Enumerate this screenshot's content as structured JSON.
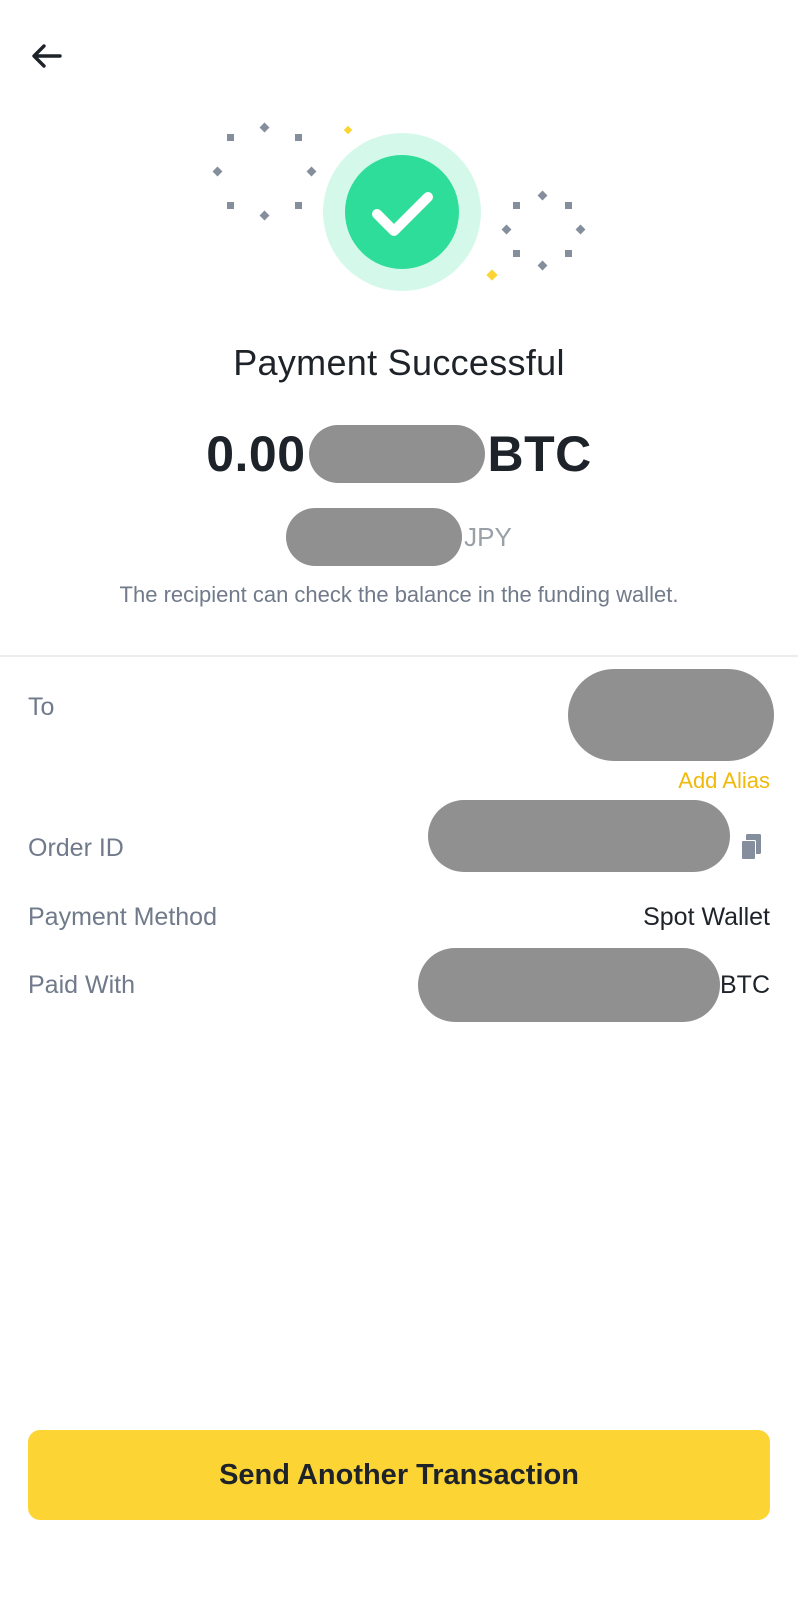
{
  "header": {
    "back_icon": "arrow-left-icon"
  },
  "hero": {
    "icon": "success-check-icon",
    "colors": {
      "check": "#2edd9a",
      "halo": "#d4f8ea",
      "dots": "#848e9c",
      "accent": "#fcd535"
    }
  },
  "title": "Payment Successful",
  "amount": {
    "prefix": "0.00",
    "unit": "BTC"
  },
  "fiat": {
    "unit": "JPY"
  },
  "note": "The recipient can check the balance in the funding wallet.",
  "details": {
    "to_label": "To",
    "add_alias": "Add Alias",
    "order_label": "Order ID",
    "copy_icon": "copy-icon",
    "method_label": "Payment Method",
    "method_value": "Spot Wallet",
    "paid_label": "Paid With",
    "paid_unit": "BTC"
  },
  "button": {
    "label": "Send Another Transaction",
    "color": "#fcd535"
  },
  "colors": {
    "text": "#1e2329",
    "muted": "#707a8a",
    "link": "#f0b90b",
    "redaction": "#909090"
  }
}
